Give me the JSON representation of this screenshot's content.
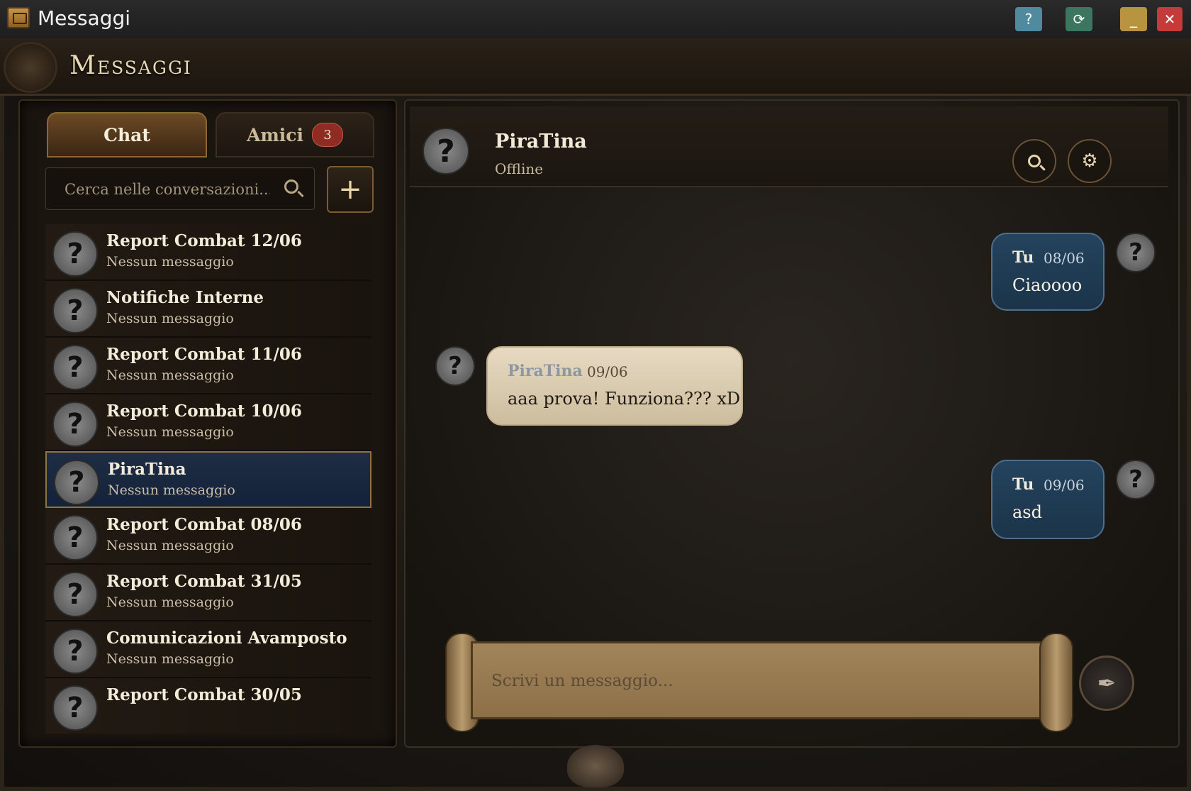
{
  "window": {
    "title": "Messaggi",
    "help_label": "?",
    "refresh_label": "⟳",
    "minimize_label": "_",
    "close_label": "✕"
  },
  "header": {
    "title": "Messaggi"
  },
  "tabs": {
    "chat": "Chat",
    "friends": "Amici",
    "friends_count": "3"
  },
  "search": {
    "placeholder": "Cerca nelle conversazioni..."
  },
  "add_label": "+",
  "conversations": [
    {
      "name": "Report Combat 12/06",
      "preview": "Nessun messaggio"
    },
    {
      "name": "Notifiche Interne",
      "preview": "Nessun messaggio"
    },
    {
      "name": "Report Combat 11/06",
      "preview": "Nessun messaggio"
    },
    {
      "name": "Report Combat 10/06",
      "preview": "Nessun messaggio"
    },
    {
      "name": "PiraTina",
      "preview": "Nessun messaggio"
    },
    {
      "name": "Report Combat 08/06",
      "preview": "Nessun messaggio"
    },
    {
      "name": "Report Combat 31/05",
      "preview": "Nessun messaggio"
    },
    {
      "name": "Comunicazioni Avamposto",
      "preview": "Nessun messaggio"
    },
    {
      "name": "Report Combat 30/05",
      "preview": ""
    }
  ],
  "chat": {
    "peer_name": "PiraTina",
    "peer_status": "Offline",
    "avatar_glyph": "?",
    "messages": [
      {
        "sender": "Tu",
        "date": "08/06",
        "text": "Ciaoooo",
        "mine": true
      },
      {
        "sender": "PiraTina",
        "date": "09/06",
        "text": "aaa prova! Funziona??? xD",
        "mine": false
      },
      {
        "sender": "Tu",
        "date": "09/06",
        "text": "asd",
        "mine": true
      }
    ],
    "composer_placeholder": "Scrivi un messaggio...",
    "gear_glyph": "⚙",
    "send_glyph": "✒"
  },
  "colors": {
    "mine_bubble": "#1b3449",
    "their_bubble": "#e7dac2",
    "selected_row": "#14213a",
    "badge": "#8e2b22"
  },
  "selected_index": 4
}
